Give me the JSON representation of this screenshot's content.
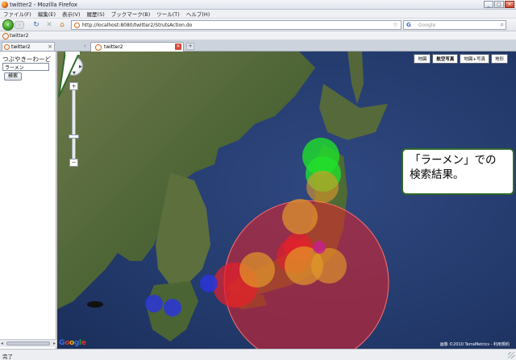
{
  "window": {
    "title": "twitter2 - Mozilla Firefox"
  },
  "menu": [
    "ファイル(F)",
    "編集(E)",
    "表示(V)",
    "履歴(S)",
    "ブックマーク(B)",
    "ツール(T)",
    "ヘルプ(H)"
  ],
  "nav": {
    "url": "http://localhost:8080/twitter2/StrutsAction.do",
    "search_placeholder": "Google",
    "search_engine": "G"
  },
  "bookmarks": {
    "item": "twitter2"
  },
  "sidebar_tab": {
    "label": "twitter2"
  },
  "tab": {
    "label": "twitter2"
  },
  "sidebar": {
    "label": "つぶやきーわーど",
    "input_value": "ラーメン",
    "button": "検索"
  },
  "map": {
    "types": [
      "地図",
      "航空写真",
      "地図+写真",
      "地形"
    ],
    "active_type": "航空写真",
    "logo": "Google",
    "copyright": "画像 ©2010 TerraMetrics - 利用規約",
    "marker_colors": {
      "red": "#e8202a",
      "orange": "#e39a2a",
      "green": "#20e02a",
      "blue": "#2a35d8",
      "magenta": "#c8208a"
    }
  },
  "callout": {
    "line1": "「ラーメン」での",
    "line2": "検索結果。"
  },
  "status": {
    "text": "完了"
  }
}
